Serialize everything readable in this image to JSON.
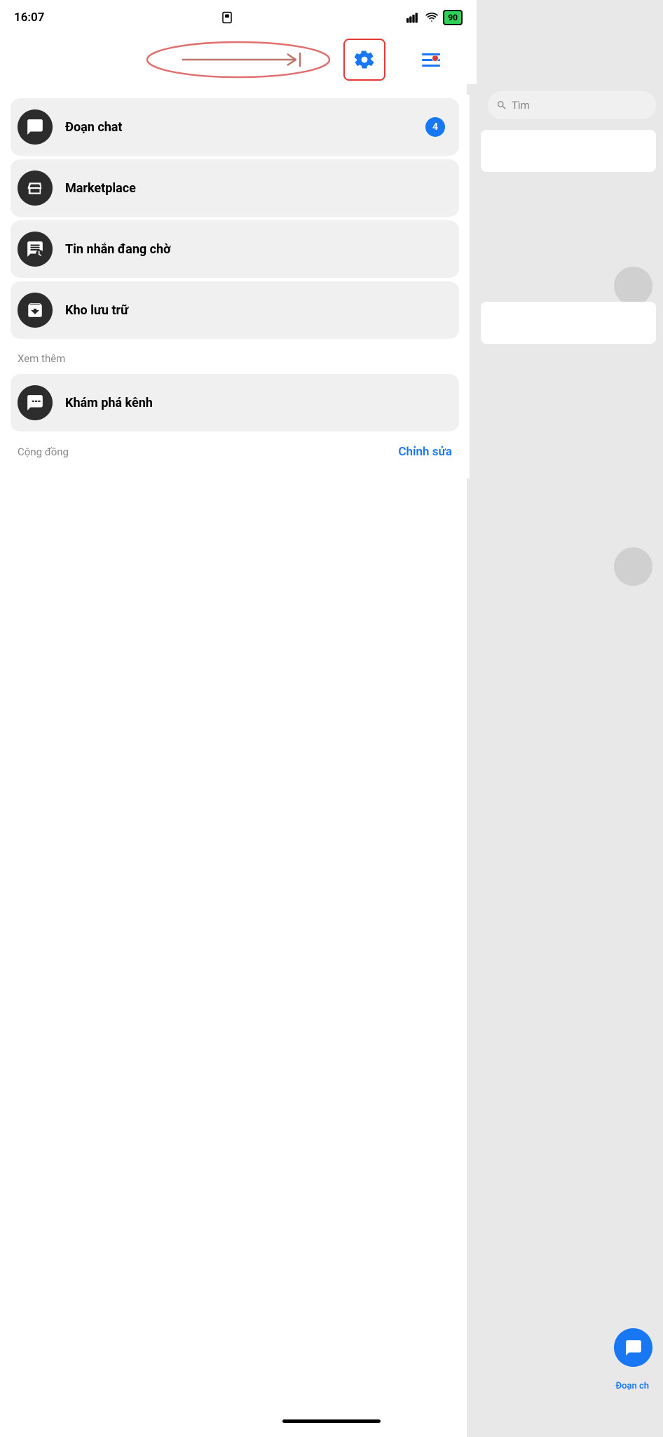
{
  "statusBar": {
    "time": "16:07",
    "battery": "90"
  },
  "header": {
    "settings_label": "Settings",
    "arrow_annotation": "→|"
  },
  "search": {
    "placeholder": "Tìm"
  },
  "menuItems": [
    {
      "id": "doan-chat",
      "label": "Đoạn chat",
      "badge": "4",
      "icon": "chat-icon"
    },
    {
      "id": "marketplace",
      "label": "Marketplace",
      "badge": "",
      "icon": "marketplace-icon"
    },
    {
      "id": "tin-nhan-dang-cho",
      "label": "Tin nhắn đang chờ",
      "badge": "",
      "icon": "pending-icon"
    },
    {
      "id": "kho-luu-tru",
      "label": "Kho lưu trữ",
      "badge": "",
      "icon": "archive-icon"
    }
  ],
  "sectionLabels": {
    "xem_them": "Xem thêm",
    "cong_dong": "Cộng đồng"
  },
  "extraItems": [
    {
      "id": "kham-pha-kenh",
      "label": "Khám phá kênh",
      "icon": "explore-icon"
    }
  ],
  "actions": {
    "chinh_sua": "Chỉnh sửa"
  },
  "rightPanel": {
    "bottom_label": "Đoạn ch"
  }
}
